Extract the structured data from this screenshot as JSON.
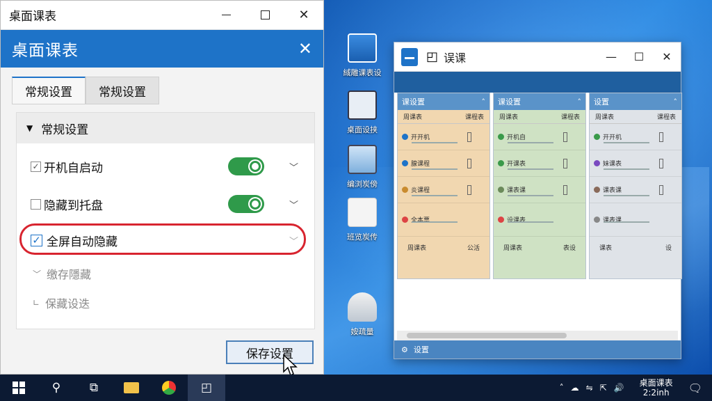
{
  "settings_window": {
    "title": "桌面课表",
    "header": "桌面课表",
    "tabs": [
      "常规设置",
      "常规设置"
    ],
    "section_title": "常规设置",
    "options": [
      {
        "label": "开机自启动",
        "checked": true,
        "toggle_on": true
      },
      {
        "label": "隐藏到托盘",
        "checked": false,
        "toggle_on": true
      },
      {
        "label": "全屏自动隐藏",
        "checked": true
      }
    ],
    "ghost_items": [
      "缴存隱藏",
      "保藏设迭"
    ],
    "save_button": "保存设置"
  },
  "desktop_icons": [
    "緎雕课表设",
    "桌面设挟",
    "编浏炭傍",
    "班览炭传",
    "姲疏量"
  ],
  "schedule_window": {
    "title": "误课",
    "columns": [
      {
        "header": "课设置",
        "sub_left": "周课表",
        "sub_right": "课程表",
        "items": [
          "开开机",
          "腺课程",
          "炎课程",
          "全本票"
        ],
        "foot_left": "周课表",
        "foot_right": "公活"
      },
      {
        "header": "课设置",
        "sub_left": "周课表",
        "sub_right": "课程表",
        "items": [
          "开机自",
          "开课表",
          "课表课",
          "设课表"
        ],
        "foot_left": "周课表",
        "foot_right": "表设"
      },
      {
        "header": "设置",
        "sub_left": "周课表",
        "sub_right": "课程表",
        "items": [
          "开开机",
          "妹课表",
          "课表课",
          "课表课"
        ],
        "foot_left": "课表",
        "foot_right": "设"
      }
    ],
    "status": "设置"
  },
  "taskbar": {
    "clock_title": "桌面课表",
    "clock_sub": "2:2inh"
  },
  "colors": {
    "accent": "#1e73c8",
    "toggle_on": "#2f9a4a",
    "highlight": "#d8242f",
    "col1_bg": "#f1d7b0",
    "col2_bg": "#cfe2c4",
    "col3_bg": "#dfe3e8"
  }
}
